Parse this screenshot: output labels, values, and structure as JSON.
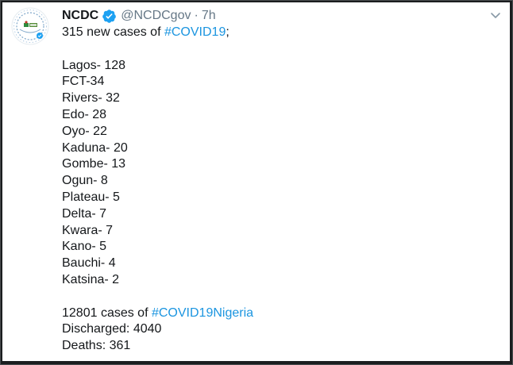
{
  "tweet": {
    "author_name": "NCDC",
    "handle": "@NCDCgov",
    "separator": "·",
    "time": "7h",
    "intro": {
      "text_before": "315 new cases of ",
      "hashtag": "#COVID19",
      "text_after": ";"
    },
    "state_cases": [
      "Lagos- 128",
      "FCT-34",
      "Rivers- 32",
      "Edo- 28",
      "Oyo- 22",
      "Kaduna- 20",
      "Gombe- 13",
      "Ogun- 8",
      "Plateau- 5",
      "Delta- 7",
      "Kwara- 7",
      "Kano- 5",
      "Bauchi- 4",
      "Katsina- 2"
    ],
    "summary": {
      "total_text_before": "12801 cases of ",
      "total_hashtag": "#COVID19Nigeria",
      "discharged": "Discharged: 4040",
      "deaths": "Deaths: 361"
    }
  },
  "colors": {
    "hashtag": "#1b95e0",
    "verified_badge": "#1da1f2",
    "muted_text": "#657786",
    "primary_text": "#14171a",
    "background_outer": "#1b1d1f"
  },
  "icons": {
    "verified": "verified-badge-icon",
    "more": "chevron-down-icon",
    "avatar": "ncdc-logo"
  }
}
